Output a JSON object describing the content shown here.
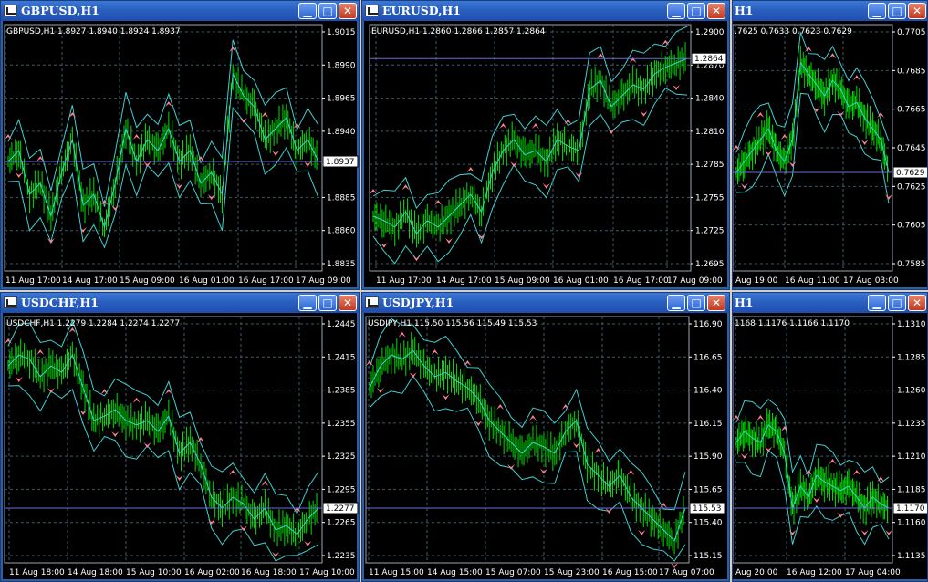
{
  "colors": {
    "background": "#000000",
    "price": "#00e000",
    "bands": "#40d0d0",
    "grid": "#3e5a6a",
    "fractal": "#ff7f8f",
    "axis_text": "#ffffff",
    "current_line": "#6b6bd8"
  },
  "windows": [
    {
      "id": "gbpusd",
      "title": "GBPUSD,H1",
      "header": "GBPUSD,H1  1.8927 1.8940 1.8924 1.8937",
      "price_labels": [
        "1.9015",
        "1.8990",
        "1.8965",
        "1.8940",
        "1.8910",
        "1.8885",
        "1.8860",
        "1.8835"
      ],
      "time_labels": [
        "11 Aug 17:00",
        "14 Aug 17:00",
        "15 Aug 09:00",
        "16 Aug 01:00",
        "16 Aug 17:00",
        "17 Aug 09:00"
      ],
      "current_price": "1.8937",
      "chart_data": {
        "type": "line",
        "x": [
          "11 Aug 17:00",
          "14 Aug 17:00",
          "15 Aug 09:00",
          "16 Aug 01:00",
          "16 Aug 17:00",
          "17 Aug 09:00"
        ],
        "last": 1.8937,
        "ylim": [
          1.8835,
          1.9015
        ]
      }
    },
    {
      "id": "eurusd",
      "title": "EURUSD,H1",
      "header": "EURUSD,H1  1.2860 1.2866 1.2857 1.2864",
      "price_labels": [
        "1.2900",
        "1.2870",
        "1.2840",
        "1.2810",
        "1.2785",
        "1.2755",
        "1.2725",
        "1.2695"
      ],
      "time_labels": [
        "11 Aug 17:00",
        "14 Aug 17:00",
        "15 Aug 09:00",
        "16 Aug 01:00",
        "16 Aug 17:00",
        "17 Aug 09:00"
      ],
      "current_price": "1.2864",
      "chart_data": {
        "type": "line",
        "x": [
          "11 Aug 17:00",
          "14 Aug 17:00",
          "15 Aug 09:00",
          "16 Aug 01:00",
          "16 Aug 17:00",
          "17 Aug 09:00"
        ],
        "last": 1.2864,
        "ylim": [
          1.2695,
          1.29
        ]
      }
    },
    {
      "id": "audusd",
      "title": "H1",
      "header": ".7625 0.7633 0.7623 0.7629",
      "price_labels": [
        "0.7705",
        "0.7685",
        "0.7665",
        "0.7645",
        "0.7625",
        "0.7605",
        "0.7585"
      ],
      "time_labels": [
        "Aug 19:00",
        "16 Aug 11:00",
        "17 Aug 03:00"
      ],
      "current_price": "0.7629",
      "chart_data": {
        "type": "line",
        "x": [
          "Aug 19:00",
          "16 Aug 11:00",
          "17 Aug 03:00"
        ],
        "last": 0.7629,
        "ylim": [
          0.7585,
          0.7705
        ]
      }
    },
    {
      "id": "usdchf",
      "title": "USDCHF,H1",
      "header": "USDCHF,H1  1.2279 1.2284 1.2274 1.2277",
      "price_labels": [
        "1.2445",
        "1.2415",
        "1.2385",
        "1.2355",
        "1.2325",
        "1.2295",
        "1.2265",
        "1.2235"
      ],
      "time_labels": [
        "11 Aug 18:00",
        "14 Aug 18:00",
        "15 Aug 10:00",
        "16 Aug 02:00",
        "16 Aug 18:00",
        "17 Aug 10:00"
      ],
      "current_price": "1.2277",
      "chart_data": {
        "type": "line",
        "x": [
          "11 Aug 18:00",
          "14 Aug 18:00",
          "15 Aug 10:00",
          "16 Aug 02:00",
          "16 Aug 18:00",
          "17 Aug 10:00"
        ],
        "last": 1.2277,
        "ylim": [
          1.2235,
          1.2445
        ]
      }
    },
    {
      "id": "usdjpy",
      "title": "USDJPY,H1",
      "header": "USDJPY,H1  115.50 115.56 115.49 115.53",
      "price_labels": [
        "116.90",
        "116.65",
        "116.40",
        "116.15",
        "115.90",
        "115.65",
        "115.40",
        "115.15"
      ],
      "time_labels": [
        "11 Aug 15:00",
        "14 Aug 15:00",
        "15 Aug 07:00",
        "15 Aug 23:00",
        "16 Aug 15:00",
        "17 Aug 07:00"
      ],
      "current_price": "115.53",
      "chart_data": {
        "type": "line",
        "x": [
          "11 Aug 15:00",
          "14 Aug 15:00",
          "15 Aug 07:00",
          "15 Aug 23:00",
          "16 Aug 15:00",
          "17 Aug 07:00"
        ],
        "last": 115.53,
        "ylim": [
          115.15,
          116.9
        ]
      }
    },
    {
      "id": "usdcad",
      "title": "H1",
      "header": "1168 1.1176 1.1166 1.1170",
      "price_labels": [
        "1.1310",
        "1.1285",
        "1.1260",
        "1.1235",
        "1.1210",
        "1.1185",
        "1.1160",
        "1.1135"
      ],
      "time_labels": [
        "Aug 20:00",
        "16 Aug 12:00",
        "17 Aug 04:00"
      ],
      "current_price": "1.1170",
      "chart_data": {
        "type": "line",
        "x": [
          "Aug 20:00",
          "16 Aug 12:00",
          "17 Aug 04:00"
        ],
        "last": 1.117,
        "ylim": [
          1.1135,
          1.131
        ]
      }
    }
  ]
}
